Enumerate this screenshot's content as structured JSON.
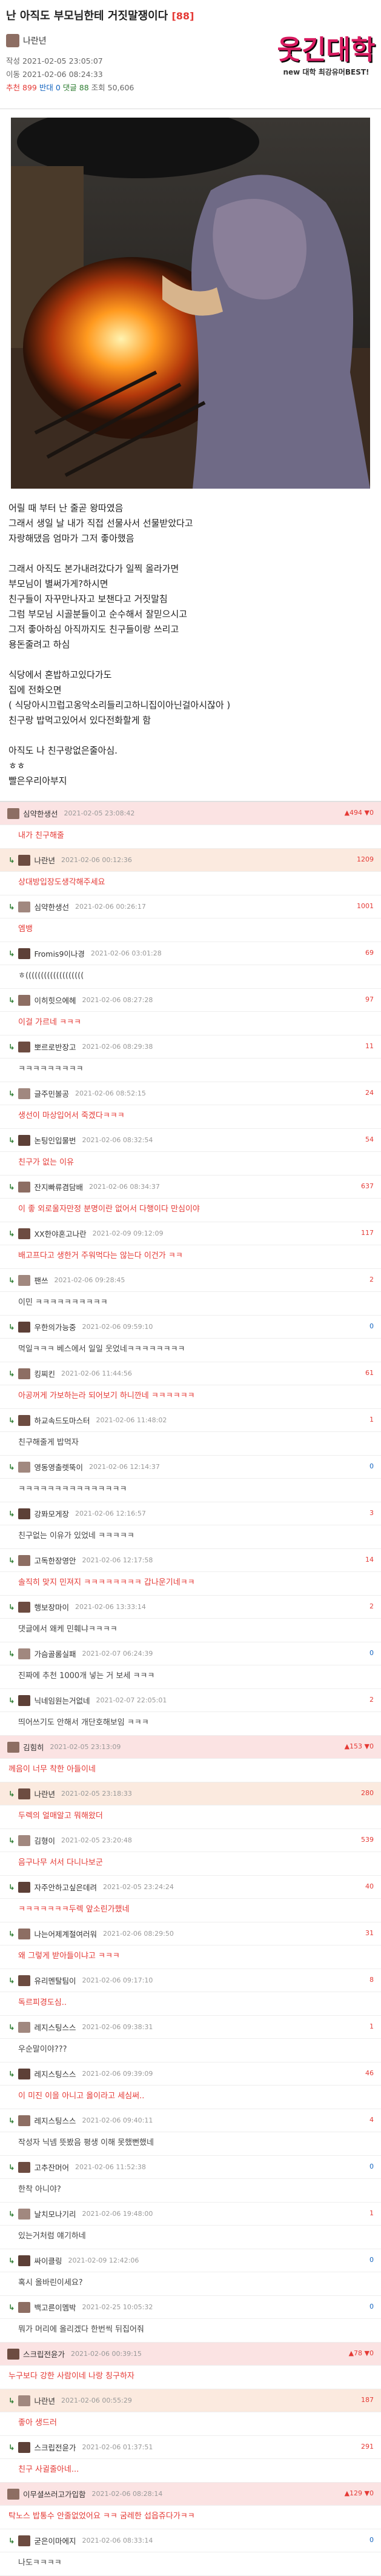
{
  "post": {
    "title": "난 아직도 부모님한테 거짓말쟁이다",
    "comment_count": "[88]",
    "author": "나란년",
    "written": "작성 2021-02-05 23:05:07",
    "edited": "이동 2021-02-06 08:24:33",
    "stats_prefix": "추천",
    "recommend": "899",
    "bad_label": "반대",
    "bad": "0",
    "reply_label": "댓글",
    "replies": "88",
    "views": "조회 50,606"
  },
  "logo": {
    "big": "웃긴대학",
    "small": "new 대학 최강유머BEST!"
  },
  "body_lines": [
    "어릴 때 부터 난 줄곧 왕따였음",
    "그래서 생일 날 내가 직접 선물사서 선물받았다고",
    "자랑해댔음 엄마가 그저 좋아했음",
    "",
    "그래서 아직도 본가내려갔다가 일찍 올라가면",
    "부모님이 별써가게?하시면",
    "친구들이 자꾸만나자고 보챈다고 거짓말침",
    "그럼 부모님 시골분들이고 순수해서 잘믿으시고",
    "그저 좋아하심 아직까지도 친구들이랑 쓰리고",
    "용돈줄려고 하심",
    "",
    "식당에서 혼밥하고있다가도",
    "집에 전화오면",
    "( 식당아시끄럽고옹악소리들리고하니집이아닌걸아시잖아 )",
    "친구랑 밥먹고있어서 있다전화할게 함",
    "",
    "아직도 나 친구랑없은줄아심.",
    "ㅎㅎ",
    "빨은우리아부지"
  ],
  "comments": [
    {
      "kind": "head",
      "nick": "심약한생선",
      "date": "2021-02-05 23:08:42",
      "badge": "▲494 ▼0",
      "cls": "best"
    },
    {
      "kind": "text",
      "text": "내가 친구해줄",
      "red": true
    },
    {
      "kind": "reply",
      "nick": "나란년",
      "date": "2021-02-06 00:12:36",
      "score": "1209",
      "cls": "best2"
    },
    {
      "kind": "text",
      "text": "상대방입장도생각해주세요",
      "red": true
    },
    {
      "kind": "reply",
      "nick": "심약한생선",
      "date": "2021-02-06 00:26:17",
      "score": "1001"
    },
    {
      "kind": "text",
      "text": "엠뱅",
      "red": true
    },
    {
      "kind": "reply",
      "nick": "Fromis9이나경",
      "date": "2021-02-06 03:01:28",
      "score": "69"
    },
    {
      "kind": "text",
      "text": "ㅎ(((((((((((((((((((",
      "red": false
    },
    {
      "kind": "reply",
      "nick": "이히힛으에헤",
      "date": "2021-02-06 08:27:28",
      "score": "97"
    },
    {
      "kind": "text",
      "text": "이걸 가르네 ㅋㅋㅋ",
      "red": true
    },
    {
      "kind": "reply",
      "nick": "뽀르로반장고",
      "date": "2021-02-06 08:29:38",
      "score": "11"
    },
    {
      "kind": "text",
      "text": "ㅋㅋㅋㅋㅋㅋㅋㅋㅋ",
      "red": false
    },
    {
      "kind": "reply",
      "nick": "글주민볼공",
      "date": "2021-02-06 08:52:15",
      "score": "24"
    },
    {
      "kind": "text",
      "text": "생선이 마상입어서 죽겠다ㅋㅋㅋ",
      "red": true
    },
    {
      "kind": "reply",
      "nick": "논팅인입물번",
      "date": "2021-02-06 08:32:54",
      "score": "54"
    },
    {
      "kind": "text",
      "text": "친구가 없는 이유",
      "red": true
    },
    {
      "kind": "reply",
      "nick": "잔지빠류겸담배",
      "date": "2021-02-06 08:34:37",
      "score": "637"
    },
    {
      "kind": "text",
      "text": "이 좋 외로울자만정 분명이란 없어서 다행이다 만심이야",
      "red": true
    },
    {
      "kind": "reply",
      "nick": "XX한야혼고나란",
      "date": "2021-02-09 09:12:09",
      "score": "117"
    },
    {
      "kind": "text",
      "text": "배고프다고 생한거 주워먹다는 않는다 이건가 ㅋㅋ",
      "red": true
    },
    {
      "kind": "reply",
      "nick": "팬쓰",
      "date": "2021-02-06 09:28:45",
      "score": "2"
    },
    {
      "kind": "text",
      "text": "이민 ㅋㅋㅋㅋㅋㅋㅋㅋㅋㅋ",
      "red": false
    },
    {
      "kind": "reply",
      "nick": "우한의가능중",
      "date": "2021-02-06 09:59:10",
      "score": "0"
    },
    {
      "kind": "text",
      "text": "먹일ㅋㅋㅋ 베스에서 일일 웃었네ㅋㅋㅋㅋㅋㅋㅋㅋ",
      "red": false
    },
    {
      "kind": "reply",
      "nick": "킹찌킨",
      "date": "2021-02-06 11:44:56",
      "score": "61"
    },
    {
      "kind": "text",
      "text": "아공꺼게 가보하는라 되어보기 하니깐네 ㅋㅋㅋㅋㅋㅋ",
      "red": true
    },
    {
      "kind": "reply",
      "nick": "하교속드도마스터",
      "date": "2021-02-06 11:48:02",
      "score": "1"
    },
    {
      "kind": "text",
      "text": "친구해줄게 밥먹자",
      "red": false
    },
    {
      "kind": "reply",
      "nick": "영동영출렛뚝이",
      "date": "2021-02-06 12:14:37",
      "score": "0"
    },
    {
      "kind": "text",
      "text": "ㅋㅋㅋㅋㅋㅋㅋㅋㅋㅋㅋㅋㅋㅋㅋ",
      "red": false
    },
    {
      "kind": "reply",
      "nick": "강퐈모게장",
      "date": "2021-02-06 12:16:57",
      "score": "3"
    },
    {
      "kind": "text",
      "text": "친구없는 이유가 있었네 ㅋㅋㅋㅋㅋ",
      "red": false
    },
    {
      "kind": "reply",
      "nick": "고독한장영안",
      "date": "2021-02-06 12:17:58",
      "score": "14"
    },
    {
      "kind": "text",
      "text": "솔직히 맞지 민져지 ㅋㅋㅋㅋㅋㅋㅋㅋ 갑나운기네ㅋㅋ",
      "red": true
    },
    {
      "kind": "reply",
      "nick": "행보장마이",
      "date": "2021-02-06 13:33:14",
      "score": "2"
    },
    {
      "kind": "text",
      "text": "댓글에서 왜케 민훼냐ㅋㅋㅋㅋ",
      "red": false
    },
    {
      "kind": "reply",
      "nick": "가슴골롬실패",
      "date": "2021-02-07 06:24:39",
      "score": "0"
    },
    {
      "kind": "text",
      "text": "진짜에 추천 1000개 넣는 거 보세 ㅋㅋㅋ",
      "red": false
    },
    {
      "kind": "reply",
      "nick": "닉네임원는거없네",
      "date": "2021-02-07 22:05:01",
      "score": "2"
    },
    {
      "kind": "text",
      "text": "띄어쓰기도 안해서 개단호해보임 ㅋㅋㅋ",
      "red": false
    },
    {
      "kind": "head",
      "nick": "김힘히",
      "date": "2021-02-05 23:13:09",
      "badge": "▲153 ▼0",
      "cls": "best"
    },
    {
      "kind": "text",
      "text": "께음이 너무 착한 아들이네",
      "red": true,
      "first": true
    },
    {
      "kind": "reply",
      "nick": "나란년",
      "date": "2021-02-05 23:18:33",
      "score": "280",
      "cls": "best2"
    },
    {
      "kind": "text",
      "text": "두렉의 얼매알고 뭐해왔더",
      "red": true
    },
    {
      "kind": "reply",
      "nick": "김형이",
      "date": "2021-02-05 23:20:48",
      "score": "539"
    },
    {
      "kind": "text",
      "text": "음구나무 서서 다니나보군",
      "red": true
    },
    {
      "kind": "reply",
      "nick": "자주안하고싶은데려",
      "date": "2021-02-05 23:24:24",
      "score": "40"
    },
    {
      "kind": "text",
      "text": "ㅋㅋㅋㅋㅋㅋㅋ두렉 앞소린가했네",
      "red": true
    },
    {
      "kind": "reply",
      "nick": "나는어제계절여러워",
      "date": "2021-02-06 08:29:50",
      "score": "31"
    },
    {
      "kind": "text",
      "text": "왜 그렇게 받아들이냐고 ㅋㅋㅋ",
      "red": true
    },
    {
      "kind": "reply",
      "nick": "유리멘탈팀이",
      "date": "2021-02-06 09:17:10",
      "score": "8"
    },
    {
      "kind": "text",
      "text": "독르피경도심..",
      "red": true
    },
    {
      "kind": "reply",
      "nick": "레지스팅스스",
      "date": "2021-02-06 09:38:31",
      "score": "1"
    },
    {
      "kind": "text",
      "text": "우순말이야???",
      "red": false
    },
    {
      "kind": "reply",
      "nick": "레지스팅스스",
      "date": "2021-02-06 09:39:09",
      "score": "46"
    },
    {
      "kind": "text",
      "text": "이 미진 이을 아니고 옳이라고 세심써..",
      "red": true
    },
    {
      "kind": "reply",
      "nick": "레지스팅스스",
      "date": "2021-02-06 09:40:11",
      "score": "4"
    },
    {
      "kind": "text",
      "text": "작성자 닉넴 뜻봤음 평생 이해 못했뻔했네",
      "red": false
    },
    {
      "kind": "reply",
      "nick": "고추잔머어",
      "date": "2021-02-06 11:52:38",
      "score": "0"
    },
    {
      "kind": "text",
      "text": "한착 아니야?",
      "red": false
    },
    {
      "kind": "reply",
      "nick": "날치모나기리",
      "date": "2021-02-06 19:48:00",
      "score": "1"
    },
    {
      "kind": "text",
      "text": "있는거처럼 얘기하네",
      "red": false
    },
    {
      "kind": "reply",
      "nick": "싸이클링",
      "date": "2021-02-09 12:42:06",
      "score": "0"
    },
    {
      "kind": "text",
      "text": "혹시 올바린이세요?",
      "red": false
    },
    {
      "kind": "reply",
      "nick": "백고른이멤박",
      "date": "2021-02-25 10:05:32",
      "score": "0"
    },
    {
      "kind": "text",
      "text": "뭐가 머리에 올리겠다 한번씩 뒤집어줘",
      "red": false
    },
    {
      "kind": "head",
      "nick": "스크립전윤가",
      "date": "2021-02-06 00:39:15",
      "badge": "▲78 ▼0",
      "cls": "best"
    },
    {
      "kind": "text",
      "text": "누구보다 강한 사람이네 나랑 칭구하자",
      "red": true,
      "first": true
    },
    {
      "kind": "reply",
      "nick": "나란년",
      "date": "2021-02-06 00:55:29",
      "score": "187",
      "cls": "best2"
    },
    {
      "kind": "text",
      "text": "좋아 생드러",
      "red": true
    },
    {
      "kind": "reply",
      "nick": "스크립전윤가",
      "date": "2021-02-06 01:37:51",
      "score": "291"
    },
    {
      "kind": "text",
      "text": "친구 사귈줄아네...",
      "red": true
    },
    {
      "kind": "head",
      "nick": "이무셜쓰러고가입함",
      "date": "2021-02-06 08:28:14",
      "badge": "▲129 ▼0",
      "cls": "best"
    },
    {
      "kind": "text",
      "text": "탁노스 밥통수 안줄없었어요 ㅋㅋ 굼레한 섭읍쥬다가ㅋㅋ",
      "red": true,
      "first": true
    },
    {
      "kind": "reply",
      "nick": "굳은이마에지",
      "date": "2021-02-06 08:33:14",
      "score": "0"
    },
    {
      "kind": "text",
      "text": "나도ㅋㅋㅋㅋ",
      "red": false
    }
  ],
  "colors": {
    "accent": "#e53935",
    "blue": "#1565c0",
    "green": "#2e7d32"
  }
}
